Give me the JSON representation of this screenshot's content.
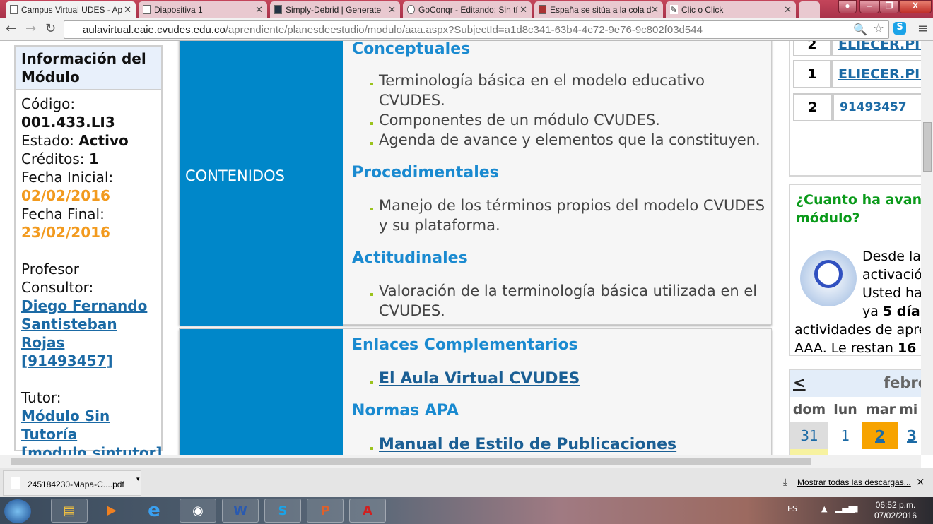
{
  "browser": {
    "tabs": [
      {
        "title": "Campus Virtual UDES - Ap"
      },
      {
        "title": "Diapositiva 1"
      },
      {
        "title": "Simply-Debrid | Generate"
      },
      {
        "title": "GoConqr - Editando: Sin tí"
      },
      {
        "title": "España se sitúa a la cola d"
      },
      {
        "title": "Clic o Click"
      }
    ],
    "url_host": "aulavirtual.eaie.cvudes.edu.co",
    "url_path": "/aprendiente/planesdeestudio/modulo/aaa.aspx?SubjectId=a1d8c341-63b4-4c72-9e76-9c802f03d544"
  },
  "info": {
    "title": "Información del Módulo",
    "codigo_label": "Código:",
    "codigo": "001.433.LI3",
    "estado_label": "Estado:",
    "estado": "Activo",
    "creditos_label": "Créditos:",
    "creditos": "1",
    "fecha_ini_label": "Fecha Inicial:",
    "fecha_ini": "02/02/2016",
    "fecha_fin_label": "Fecha Final:",
    "fecha_fin": "23/02/2016",
    "profesor_label": "Profesor Consultor:",
    "profesor": [
      "Diego Fernando",
      "Santisteban",
      "Rojas",
      "[91493457]"
    ],
    "tutor_label": "Tutor:",
    "tutor": [
      "Módulo Sin",
      "Tutoría",
      "[modulo.sintutor]"
    ]
  },
  "contenidos": {
    "label": "CONTENIDOS",
    "sections": [
      {
        "title": "Conceptuales",
        "items": [
          "Terminología básica en el modelo educativo CVUDES.",
          "Componentes de un módulo CVUDES.",
          "Agenda de avance y elementos que la constituyen."
        ]
      },
      {
        "title": "Procedimentales",
        "items": [
          "Manejo de los términos propios del modelo CVUDES y su plataforma."
        ]
      },
      {
        "title": "Actitudinales",
        "items": [
          "Valoración de la terminología básica utilizada en el CVUDES."
        ]
      }
    ]
  },
  "enlaces": {
    "title": "Enlaces Complementarios",
    "link": "El Aula Virtual CVUDES",
    "apa_title": "Normas APA",
    "apa_link": "Manual de Estilo de Publicaciones"
  },
  "right": {
    "rows": [
      {
        "n": "2",
        "user": "ELIECER.PINE"
      },
      {
        "n": "1",
        "user": "ELIECER.PINE"
      },
      {
        "n": "2",
        "user": "91493457"
      }
    ],
    "progress_title": "¿Cuanto ha avan módulo?",
    "progress_lines": [
      "Desde la",
      "activación",
      "Usted ha",
      "ya"
    ],
    "dias": "5 día(",
    "progress_tail1": "actividades de apre",
    "progress_tail2": "AAA. Le restan",
    "restan": "16",
    "cal": {
      "prev": "<",
      "month": "febre",
      "days": [
        "dom",
        "lun",
        "mar",
        "mi"
      ],
      "dates": [
        "31",
        "1",
        "2",
        "3"
      ]
    }
  },
  "downloads": {
    "file": "245184230-Mapa-C....pdf",
    "show_all": "Mostrar todas las descargas...",
    "close": "×"
  },
  "taskbar": {
    "lang": "ES",
    "time": "06:52 p.m.",
    "date": "07/02/2016"
  }
}
